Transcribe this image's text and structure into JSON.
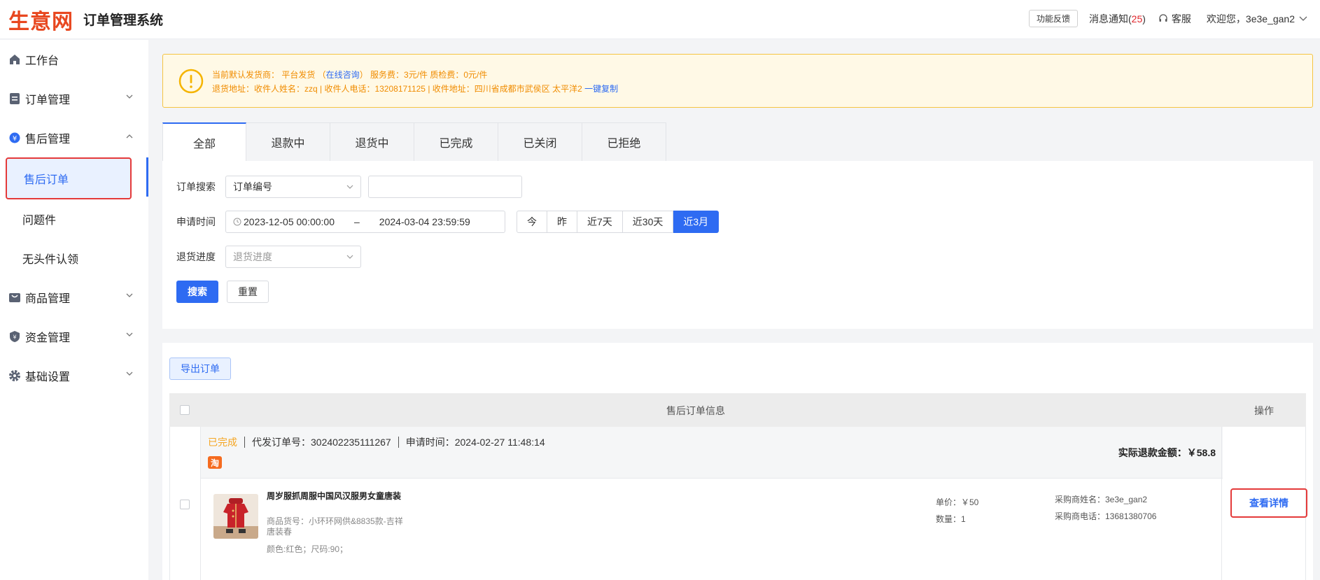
{
  "header": {
    "logo": "生意网",
    "title": "订单管理系统",
    "feedback": "功能反馈",
    "messages_label": "消息通知(",
    "messages_count": "25",
    "messages_close": ")",
    "service": "客服",
    "welcome": "欢迎您，3e3e_gan2"
  },
  "sidebar": {
    "workbench": "工作台",
    "orders": "订单管理",
    "aftersale": "售后管理",
    "sub_aftersale_order": "售后订单",
    "sub_problem": "问题件",
    "sub_headless": "无头件认领",
    "goods": "商品管理",
    "funds": "资金管理",
    "settings": "基础设置"
  },
  "notice": {
    "line1": "当前默认发货商： 平台发货 （",
    "consult": "在线咨询",
    "line1b": "） 服务费：3元/件 质检费：0元/件",
    "line2": "退货地址：收件人姓名：zzq | 收件人电话：13208171125 | 收件地址：四川省成都市武侯区 太平洋2",
    "copy": "一键复制"
  },
  "tabs": [
    "全部",
    "退款中",
    "退货中",
    "已完成",
    "已关闭",
    "已拒绝"
  ],
  "filter": {
    "search_label": "订单搜索",
    "search_type": "订单编号",
    "search_value": "",
    "time_label": "申请时间",
    "start": "2023-12-05 00:00:00",
    "dash": "–",
    "end": "2024-03-04 23:59:59",
    "quick": [
      "今",
      "昨",
      "近7天",
      "近30天",
      "近3月"
    ],
    "progress_label": "退货进度",
    "progress_placeholder": "退货进度",
    "search_btn": "搜索",
    "reset_btn": "重置"
  },
  "list": {
    "export": "导出订单",
    "col_info": "售后订单信息",
    "col_op": "操作"
  },
  "order": {
    "status": "已完成",
    "proxy_no": "代发订单号：302402235111267",
    "apply_time": "申请时间：2024-02-27 11:48:14",
    "badge": "淘",
    "refund": "实际退款金额：￥58.8",
    "product_name": "周岁服抓周服中国风汉服男女童唐装",
    "sku": "商品货号：小环环网供&8835款-吉祥唐装春",
    "attrs": "颜色:红色；尺码:90；",
    "unit_price": "单价：￥50",
    "quantity": "数量：1",
    "buyer_name": "采购商姓名：3e3e_gan2",
    "buyer_phone": "采购商电话：13681380706",
    "detail_btn": "查看详情"
  },
  "colors": {
    "primary": "#2e6bf2",
    "warning": "#f08c00",
    "highlight": "#e43a3a",
    "status": "#f5a623"
  }
}
